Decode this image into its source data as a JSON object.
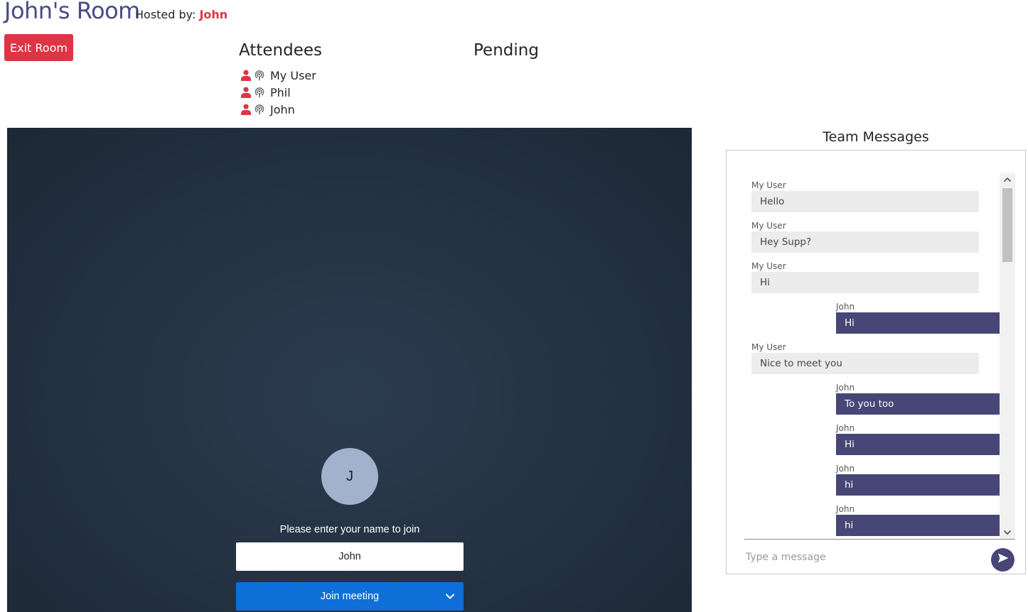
{
  "header": {
    "room_title": "John's Room",
    "hosted_by_label": "Hosted by:",
    "host_name": "John",
    "exit_button": "Exit Room"
  },
  "attendees": {
    "heading": "Attendees",
    "list": [
      {
        "name": "My User",
        "icons": [
          "user-icon",
          "podcast-icon"
        ]
      },
      {
        "name": "Phil",
        "icons": [
          "user-icon",
          "podcast-icon"
        ]
      },
      {
        "name": "John",
        "icons": [
          "user-icon",
          "podcast-icon"
        ]
      }
    ]
  },
  "pending": {
    "heading": "Pending"
  },
  "meeting": {
    "avatar_initial": "J",
    "join_prompt": "Please enter your name to join",
    "name_value": "John",
    "join_button": "Join meeting",
    "join_dropdown_icon": "chevron-down-icon"
  },
  "team_messages": {
    "heading": "Team Messages",
    "messages": [
      {
        "sender": "My User",
        "text": "Hello",
        "mine": false
      },
      {
        "sender": "My User",
        "text": "Hey Supp?",
        "mine": false
      },
      {
        "sender": "My User",
        "text": "Hi",
        "mine": false
      },
      {
        "sender": "John",
        "text": "Hi",
        "mine": true
      },
      {
        "sender": "My User",
        "text": "Nice to meet you",
        "mine": false
      },
      {
        "sender": "John",
        "text": "To you too",
        "mine": true
      },
      {
        "sender": "John",
        "text": "Hi",
        "mine": true
      },
      {
        "sender": "John",
        "text": "hi",
        "mine": true
      },
      {
        "sender": "John",
        "text": "hi",
        "mine": true
      }
    ],
    "input_placeholder": "Type a message",
    "send_icon": "send-icon"
  },
  "colors": {
    "title": "#4a4a85",
    "danger": "#dc3545",
    "join_button": "#0f6fd8",
    "own_bubble": "#464776",
    "other_bubble": "#ececec"
  }
}
